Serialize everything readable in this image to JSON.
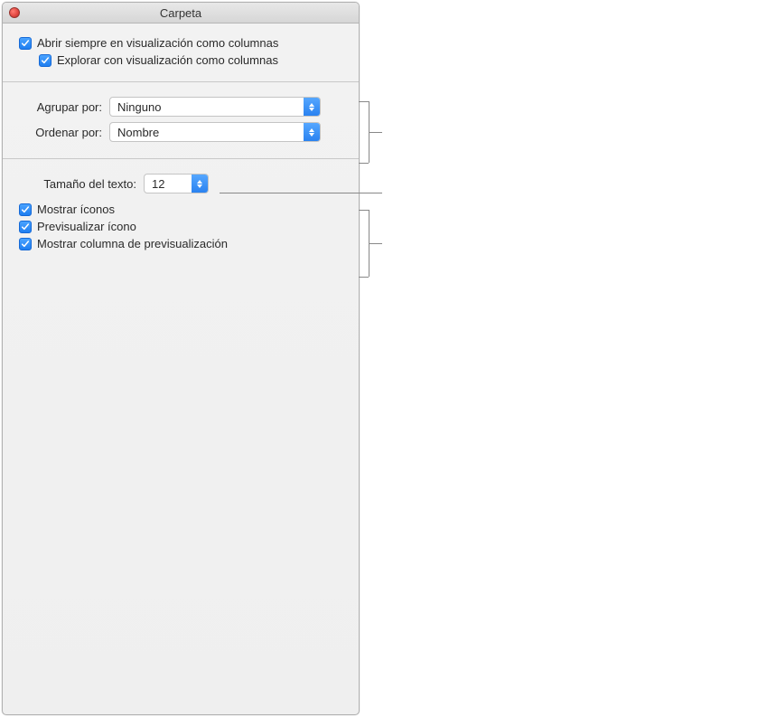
{
  "window": {
    "title": "Carpeta"
  },
  "section1": {
    "always_open_columns": "Abrir siempre en visualización como columnas",
    "browse_columns": "Explorar con visualización como columnas"
  },
  "section2": {
    "group_by_label": "Agrupar por:",
    "group_by_value": "Ninguno",
    "sort_by_label": "Ordenar por:",
    "sort_by_value": "Nombre"
  },
  "section3": {
    "text_size_label": "Tamaño del texto:",
    "text_size_value": "12",
    "show_icons": "Mostrar íconos",
    "preview_icon": "Previsualizar ícono",
    "show_preview_column": "Mostrar columna de previsualización"
  }
}
